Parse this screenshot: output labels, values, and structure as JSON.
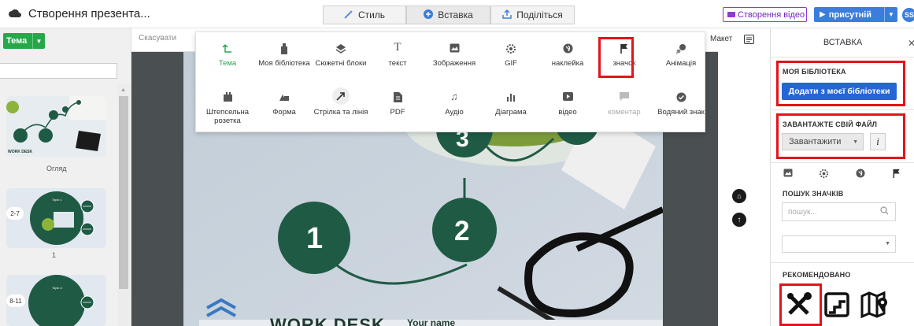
{
  "app": {
    "title": "Створення презента..."
  },
  "mode_tabs": [
    {
      "label": "Стиль",
      "icon": "wand-icon"
    },
    {
      "label": "Вставка",
      "icon": "plus-circle-icon"
    },
    {
      "label": "Поділіться",
      "icon": "share-icon"
    }
  ],
  "header": {
    "video_label": "Створення відео",
    "present_label": "присутній",
    "avatar_initials": "SS"
  },
  "left": {
    "theme_label": "Тема",
    "thumb1_label": "Огляд",
    "thumb2_badge": "2-7",
    "thumb2_label": "1",
    "thumb3_badge": "8-11",
    "thumb1_caption": "WORK DESK",
    "thumb2_topic": "Topic 1",
    "thumb3_topic": "Topic 4"
  },
  "editbar": {
    "cancel_label": "Скасувати",
    "layout_label": "Макет"
  },
  "slide": {
    "numbers": [
      "1",
      "2",
      "3"
    ],
    "title_partial": "WORK DESK",
    "your_name": "Your name"
  },
  "insert_menu": {
    "row1": [
      {
        "label": "Тема",
        "icon": "theme-icon",
        "active": true
      },
      {
        "label": "Моя бібліотека",
        "icon": "library-icon"
      },
      {
        "label": "Сюжетні блоки",
        "icon": "layers-icon"
      },
      {
        "label": "текст",
        "icon": "text-icon"
      },
      {
        "label": "Зображення",
        "icon": "image-icon"
      },
      {
        "label": "GIF",
        "icon": "gif-icon"
      },
      {
        "label": "наклейка",
        "icon": "sticker-icon"
      },
      {
        "label": "значок",
        "icon": "flag-icon"
      },
      {
        "label": "Анімація",
        "icon": "animation-icon"
      }
    ],
    "row2": [
      {
        "label": "Штепсельна розетка",
        "icon": "plugin-icon"
      },
      {
        "label": "Форма",
        "icon": "shape-icon"
      },
      {
        "label": "Стрілка та лінія",
        "icon": "arrow-icon"
      },
      {
        "label": "PDF",
        "icon": "pdf-icon"
      },
      {
        "label": "Аудіо",
        "icon": "music-icon"
      },
      {
        "label": "Діаграма",
        "icon": "chart-icon"
      },
      {
        "label": "відео",
        "icon": "video-icon"
      },
      {
        "label": "коментар",
        "icon": "comment-icon",
        "disabled": true
      },
      {
        "label": "Водяний знак",
        "icon": "watermark-icon"
      }
    ]
  },
  "right_panel": {
    "title": "ВСТАВКА",
    "my_library_label": "МОЯ БІБЛІОТЕКА",
    "add_library_button": "Додати з моєї бібліотеки",
    "upload_label": "ЗАВАНТАЖТЕ СВІЙ ФАЙЛ",
    "upload_button": "Завантажити",
    "info_label": "i",
    "search_label": "ПОШУК ЗНАЧКІВ",
    "search_placeholder": "пошук...",
    "recommended_label": "РЕКОМЕНДОВАНО",
    "recommended_icons": [
      "tools-icon",
      "stairs-icon",
      "map-pin-icon"
    ]
  },
  "colors": {
    "accent_green": "#27a74a",
    "slide_green": "#1f5a45",
    "primary_blue": "#2566d6",
    "highlight_red": "#e2141c",
    "video_purple": "#8c3bd1"
  }
}
